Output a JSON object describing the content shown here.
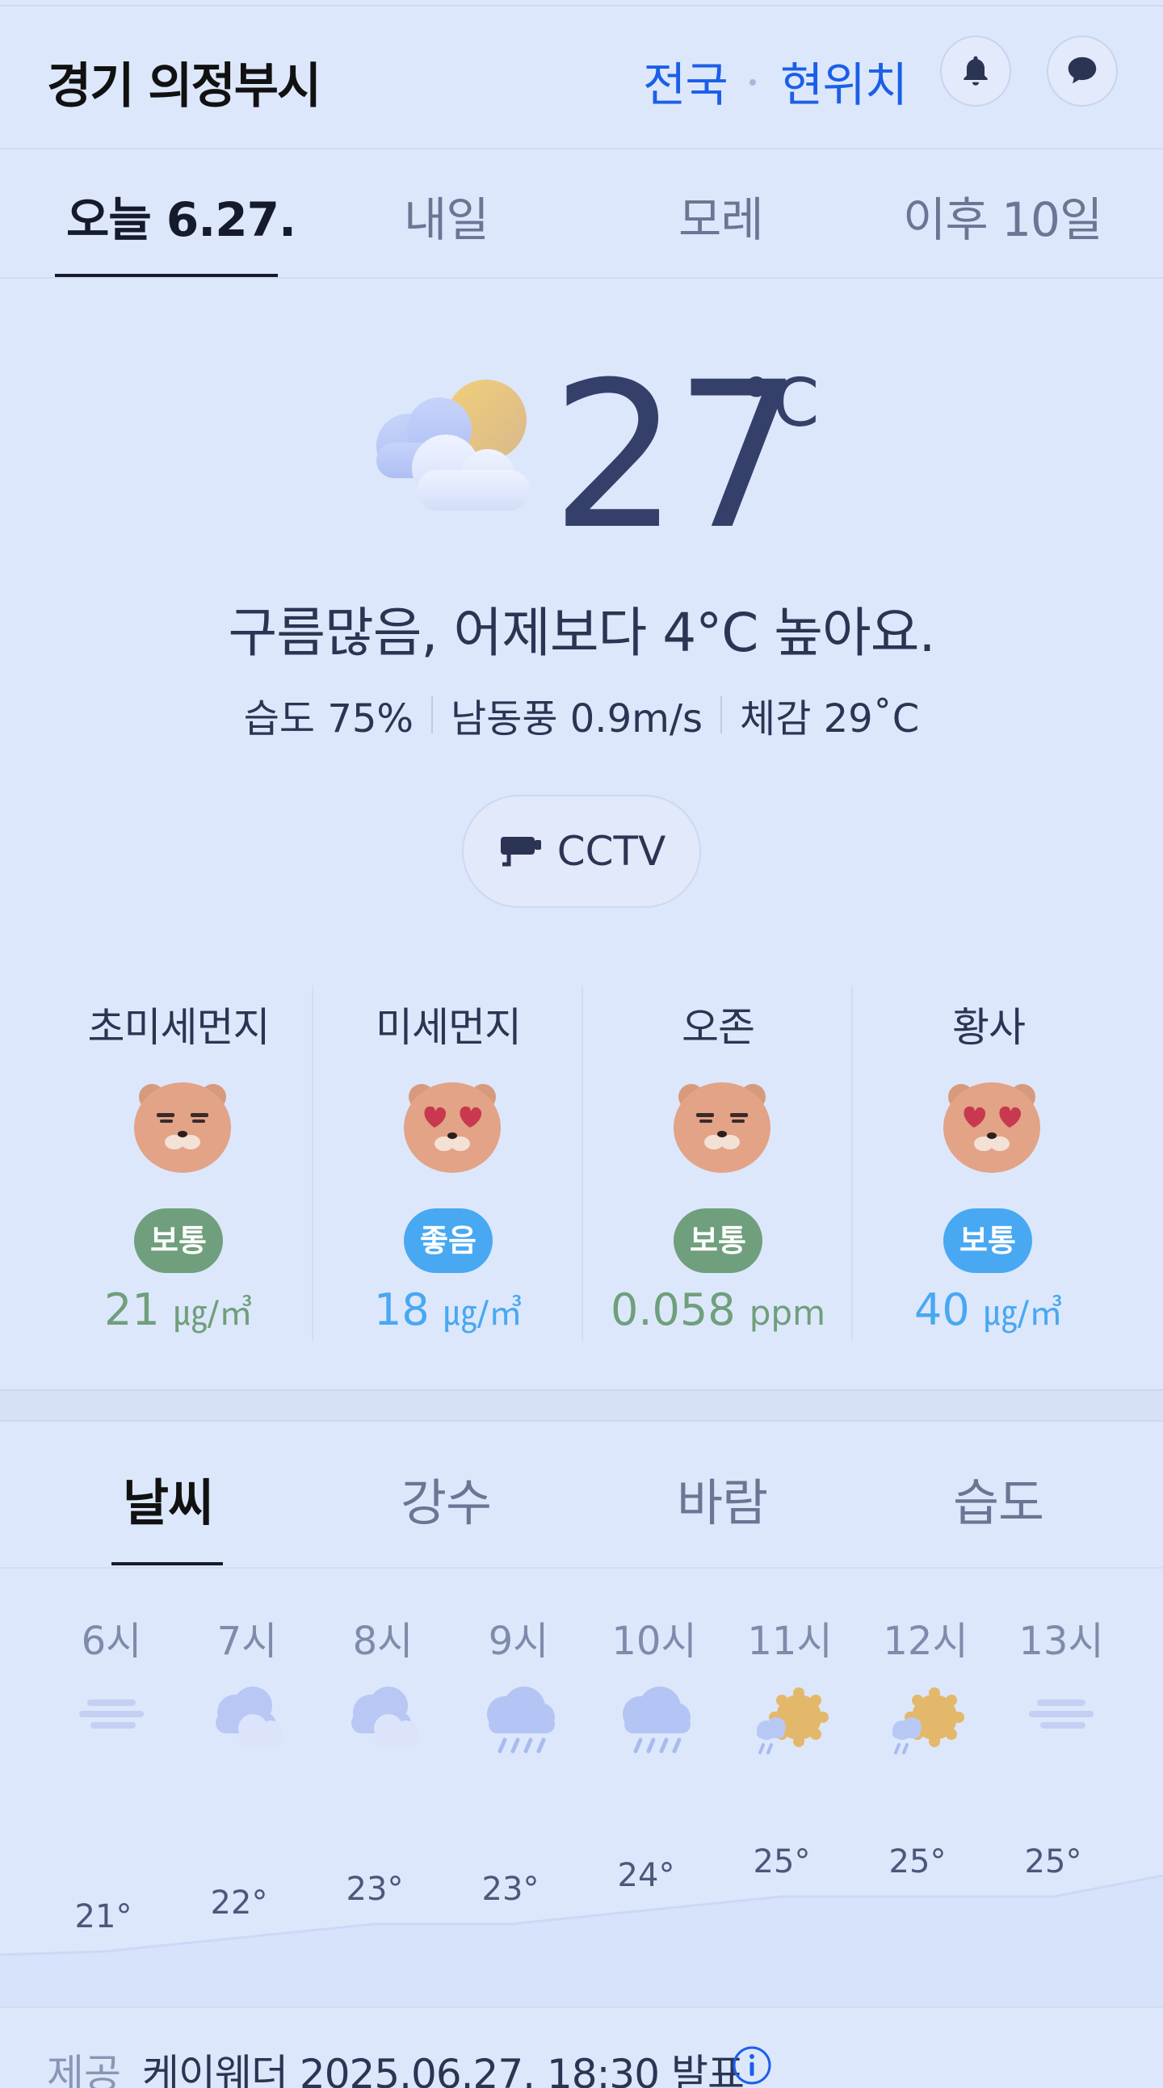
{
  "header": {
    "location": "경기 의정부시",
    "nationwide_label": "전국",
    "current_location_label": "현위치",
    "icons": [
      "bell-icon",
      "chat-icon"
    ]
  },
  "day_tabs": [
    {
      "label": "오늘 6.27.",
      "active": true
    },
    {
      "label": "내일",
      "active": false
    },
    {
      "label": "모레",
      "active": false
    },
    {
      "label": "이후 10일",
      "active": false
    }
  ],
  "current": {
    "temperature": "27",
    "unit": "°C",
    "condition_icon": "partly-cloudy-icon",
    "summary": "구름많음, 어제보다 4°C 높아요.",
    "humidity": "습도 75%",
    "wind": "남동풍 0.9m/s",
    "feels_like": "체감 29˚C",
    "cctv_label": "CCTV"
  },
  "air_quality": [
    {
      "title": "초미세먼지",
      "face": "neutral",
      "status": "보통",
      "value": "21",
      "unit": "㎍/㎥",
      "level": "normal"
    },
    {
      "title": "미세먼지",
      "face": "heart-eyes",
      "status": "좋음",
      "value": "18",
      "unit": "㎍/㎥",
      "level": "good"
    },
    {
      "title": "오존",
      "face": "neutral",
      "status": "보통",
      "value": "0.058",
      "unit": "ppm",
      "level": "normal"
    },
    {
      "title": "황사",
      "face": "heart-eyes",
      "status": "보통",
      "value": "40",
      "unit": "㎍/㎥",
      "level": "good"
    }
  ],
  "sub_tabs": [
    {
      "label": "날씨",
      "active": true
    },
    {
      "label": "강수",
      "active": false
    },
    {
      "label": "바람",
      "active": false
    },
    {
      "label": "습도",
      "active": false
    }
  ],
  "hourly": [
    {
      "hour": "6시",
      "icon": "haze-icon",
      "temp": "21°"
    },
    {
      "hour": "7시",
      "icon": "cloudy-icon",
      "temp": "22°"
    },
    {
      "hour": "8시",
      "icon": "cloudy-icon",
      "temp": "23°"
    },
    {
      "hour": "9시",
      "icon": "rain-icon",
      "temp": "23°"
    },
    {
      "hour": "10시",
      "icon": "rain-icon",
      "temp": "24°"
    },
    {
      "hour": "11시",
      "icon": "sun-shower-icon",
      "temp": "25°"
    },
    {
      "hour": "12시",
      "icon": "sun-shower-icon",
      "temp": "25°"
    },
    {
      "hour": "13시",
      "icon": "haze-icon",
      "temp": "25°"
    }
  ],
  "footer": {
    "label": "제공",
    "text": "케이웨더 2025.06.27. 18:30 발표"
  },
  "colors": {
    "background": "#dde7fb",
    "link_blue": "#1b5fe8",
    "normal_green": "#6f9f7c",
    "good_blue": "#48a8f2"
  }
}
